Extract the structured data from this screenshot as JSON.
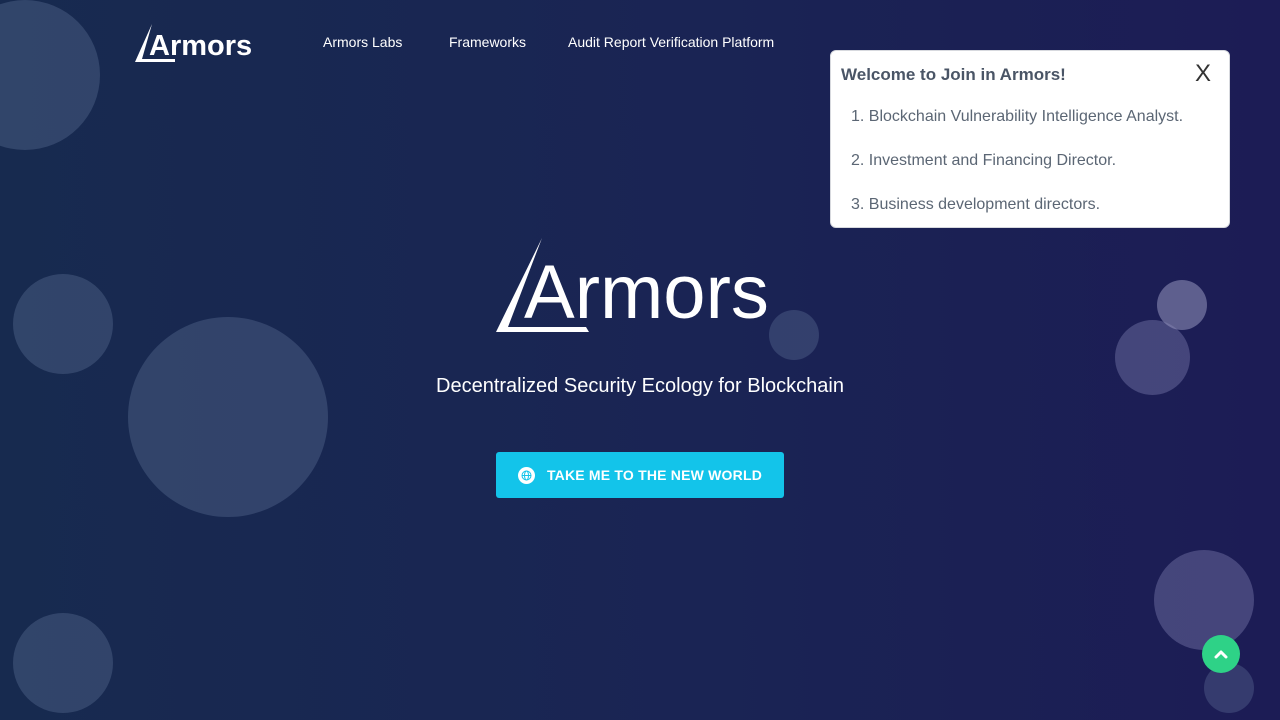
{
  "brand": {
    "logo_text": "Armors",
    "tagline": "Decentralized Security Ecology for Blockchain"
  },
  "nav": {
    "items": [
      {
        "label": "Armors Labs"
      },
      {
        "label": "Frameworks"
      },
      {
        "label": "Audit Report Verification Platform"
      }
    ]
  },
  "cta": {
    "label": "TAKE ME TO THE NEW WORLD",
    "icon": "globe-icon"
  },
  "popup": {
    "title": "Welcome to Join in Armors!",
    "close_label": "X",
    "items": [
      "1. Blockchain Vulnerability Intelligence Analyst.",
      "2. Investment and Financing Director.",
      "3. Business development directors."
    ]
  },
  "scroll_top": {
    "icon": "chevron-up-icon"
  },
  "colors": {
    "background_left": "#172a4f",
    "background_right": "#1c1c55",
    "cta": "#13c4ea",
    "scroll_top": "#2ed287"
  }
}
